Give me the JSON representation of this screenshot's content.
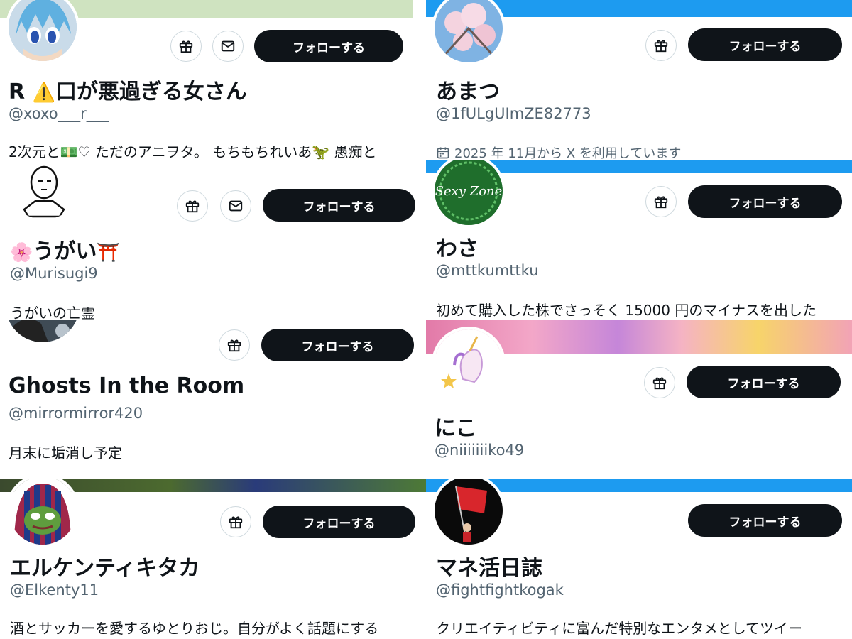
{
  "follow_label": "フォローする",
  "colors": {
    "accent": "#1d9bf0",
    "button_bg": "#0f1419",
    "text": "#0f1419",
    "secondary": "#536471"
  },
  "cards": [
    {
      "name_prefix": "R",
      "name_icon": "⚠️",
      "name": "口が悪過ぎる女さん",
      "handle": "@xoxo___r___",
      "bio_a": "2次元と",
      "bio_icon": "💵",
      "bio_b": "♡ ただのアニヲタ。 もちもちれいあ",
      "bio_icon2": "🦖",
      "bio_c": " 愚痴と"
    },
    {
      "name": "あまつ",
      "handle": "@1fULgUImZE82773",
      "joined": "2025 年 11月から X を利用しています"
    },
    {
      "name_icon": "🌸",
      "name": "うがい",
      "name_icon2": "⛩️",
      "handle": "@Murisugi9",
      "bio": "うがいの亡霊"
    },
    {
      "name": "わさ",
      "handle": "@mttkumttku",
      "bio": "初めて購入した株でさっそく 15000 円のマイナスを出した",
      "avatar_text": "Sexy Zone"
    },
    {
      "name": "Ghosts In the Room",
      "handle": "@mirrormirror420",
      "bio": "月末に垢消し予定"
    },
    {
      "name": "にこ",
      "handle": "@niiiiiiiko49"
    },
    {
      "name": "エルケンティキタカ",
      "handle": "@Elkenty11",
      "bio": "酒とサッカーを愛するゆとりおじ。自分がよく話題にする"
    },
    {
      "name": "マネ活日誌",
      "handle": "@fightfightkogak",
      "bio": "クリエイティビティに富んだ特別なエンタメとしてツイー"
    }
  ]
}
